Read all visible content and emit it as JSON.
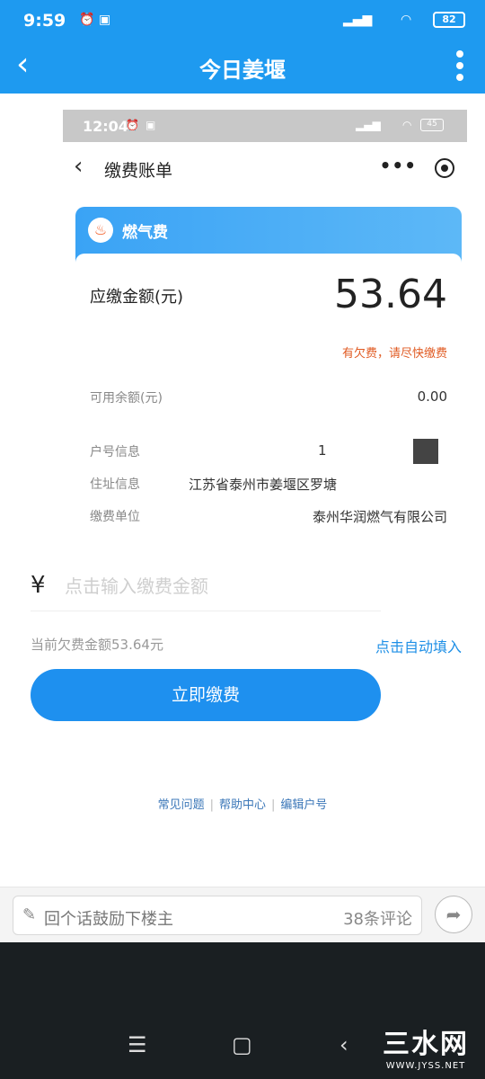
{
  "status_bar": {
    "time": "9:59",
    "battery": "82"
  },
  "app_bar": {
    "title": "今日姜堰"
  },
  "embedded": {
    "status": {
      "time": "12:04",
      "battery": "45"
    },
    "header": {
      "title": "缴费账单"
    },
    "card": {
      "type_label": "燃气费",
      "amount_label": "应缴金额(元)",
      "amount_value": "53.64",
      "arrears_note": "有欠费，请尽快缴费",
      "balance_label": "可用余额(元)",
      "balance_value": "0.00",
      "account_label": "户号信息",
      "account_value": "1",
      "address_label": "住址信息",
      "address_value": "江苏省泰州市姜堰区罗塘",
      "unit_label": "缴费单位",
      "unit_value": "泰州华润燃气有限公司"
    },
    "payment": {
      "currency_symbol": "¥",
      "input_placeholder": "点击输入缴费金额",
      "owed_text": "当前欠费金额53.64元",
      "autofill_label": "点击自动填入",
      "pay_button": "立即缴费"
    },
    "links": [
      "常见问题",
      "帮助中心",
      "编辑户号"
    ]
  },
  "comment_bar": {
    "placeholder": "回个话鼓励下楼主",
    "count": "38条评论"
  },
  "watermark": {
    "big": "三水网",
    "small": "WWW.JYSS.NET"
  },
  "colors": {
    "primary": "#1e9af0",
    "button": "#1e90ef",
    "warning": "#e05a22",
    "link": "#3b77b8"
  },
  "icons": [
    "back-icon",
    "more-icon",
    "flame-icon",
    "target-icon",
    "pen-icon",
    "share-icon",
    "menu-icon",
    "home-icon"
  ]
}
